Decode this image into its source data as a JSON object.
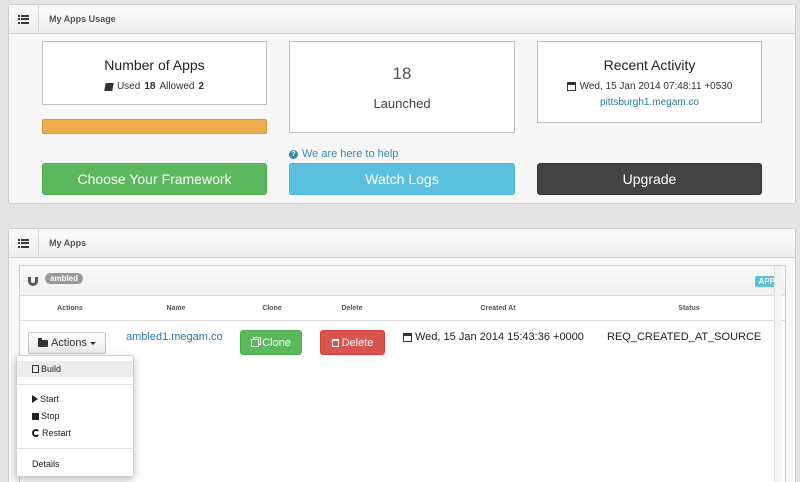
{
  "usage": {
    "title": "My Apps Usage",
    "num_apps": {
      "title": "Number of Apps",
      "used_label": "Used",
      "used": "18",
      "allowed_label": "Allowed",
      "allowed": "2"
    },
    "launched": {
      "count": "18",
      "label": "Launched"
    },
    "recent": {
      "title": "Recent Activity",
      "timestamp": "Wed, 15 Jan 2014 07:48:11 +0530",
      "link": "pittsburgh1.megam.co"
    },
    "progress_fraction": 1.0,
    "help_text": "We are here to help",
    "buttons": {
      "framework": "Choose Your Framework",
      "logs": "Watch Logs",
      "upgrade": "Upgrade"
    }
  },
  "apps": {
    "title": "My Apps",
    "app_badge": "ambled",
    "app_tag": "APP",
    "columns": [
      "Actions",
      "Name",
      "Clone",
      "Delete",
      "Created At",
      "Status"
    ],
    "row": {
      "actions_label": "Actions",
      "name": "ambled1.megam.co",
      "clone_label": "Clone",
      "delete_label": "Delete",
      "created_at": "Wed, 15 Jan 2014 15:43:36 +0000",
      "status": "REQ_CREATED_AT_SOURCE"
    },
    "menu": {
      "build": "Build",
      "start": "Start",
      "stop": "Stop",
      "restart": "Restart",
      "details": "Details"
    }
  },
  "colors": {
    "green": "#5cb85c",
    "blue": "#5bc0de",
    "dark": "#444444",
    "red": "#d9534f",
    "orange": "#f0ad4e",
    "link": "#2a7ab0"
  }
}
